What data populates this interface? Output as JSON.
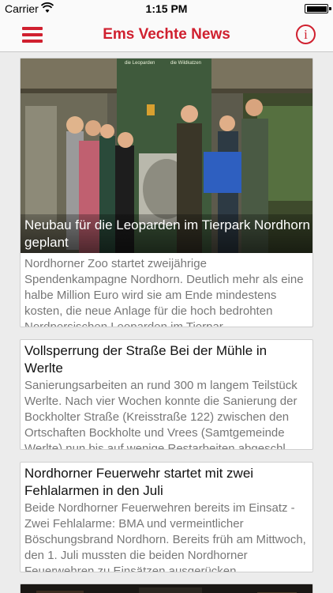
{
  "status_bar": {
    "carrier": "Carrier",
    "time": "1:15 PM"
  },
  "nav": {
    "title": "Ems Vechte News",
    "info_glyph": "i",
    "accent_color": "#d0202f"
  },
  "photo_signs": {
    "left": "die Leoparden",
    "right": "die Wildkatzen"
  },
  "articles": [
    {
      "headline": "Neubau für die Leoparden im Tierpark Nordhorn geplant",
      "teaser": "Nordhorner Zoo startet zweijährige Spendenkampagne Nordhorn. Deutlich mehr als eine halbe Million Euro wird sie am Ende mindestens kosten, die neue Anlage für die hoch bedrohten Nordpersischen Leoparden im Tierpar..."
    },
    {
      "headline": "Vollsperrung der Straße Bei der Mühle in Werlte",
      "teaser": "Sanierungsarbeiten an rund 300 m langem Teilstück Werlte. Nach vier Wochen konnte die Sanierung der Bockholter Straße (Kreisstraße 122) zwischen den Ortschaften Bockholte und Vrees (Samtgemeinde Werlte) nun bis auf wenige Restarbeiten abgeschl..."
    },
    {
      "headline": "Nordhorner Feuerwehr startet mit zwei Fehlalarmen in den Juli",
      "teaser": "Beide Nordhorner Feuerwehren bereits im Einsatz - Zwei Fehlalarme: BMA und vermeintlicher Böschungsbrand Nordhorn. Bereits früh am Mittwoch, den 1. Juli mussten die beiden Nordhorner Feuerwehren zu Einsätzen ausgerücken..."
    }
  ]
}
